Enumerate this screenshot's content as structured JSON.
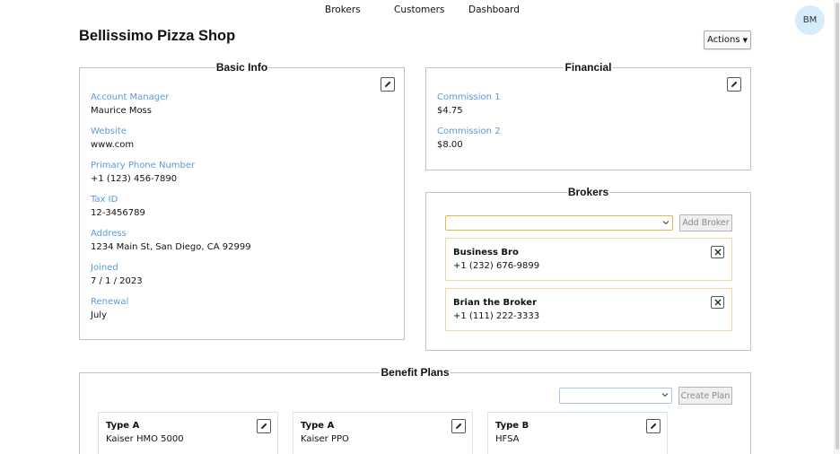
{
  "nav": {
    "items": [
      "Brokers",
      "Customers",
      "Dashboard"
    ]
  },
  "user": {
    "initials": "BM"
  },
  "page": {
    "title": "Bellissimo Pizza Shop",
    "actions_label": "Actions"
  },
  "basic_info": {
    "legend": "Basic Info",
    "fields": [
      {
        "label": "Account Manager",
        "value": "Maurice Moss"
      },
      {
        "label": "Website",
        "value": "www.com"
      },
      {
        "label": "Primary Phone Number",
        "value": "+1 (123) 456-7890"
      },
      {
        "label": "Tax ID",
        "value": "12-3456789"
      },
      {
        "label": "Address",
        "value": "1234 Main St, San Diego, CA 92999"
      },
      {
        "label": "Joined",
        "value": "7 / 1 / 2023"
      },
      {
        "label": "Renewal",
        "value": "July"
      }
    ]
  },
  "financial": {
    "legend": "Financial",
    "fields": [
      {
        "label": "Commission 1",
        "value": "$4.75"
      },
      {
        "label": "Commission 2",
        "value": "$8.00"
      }
    ]
  },
  "brokers": {
    "legend": "Brokers",
    "select_value": "",
    "add_label": "Add Broker",
    "list": [
      {
        "name": "Business Bro",
        "phone": "+1 (232) 676-9899"
      },
      {
        "name": "Brian the Broker",
        "phone": "+1 (111) 222-3333"
      }
    ]
  },
  "benefit_plans": {
    "legend": "Benefit Plans",
    "select_value": "",
    "create_label": "Create Plan",
    "plans": [
      {
        "type": "Type A",
        "name": "Kaiser HMO 5000"
      },
      {
        "type": "Type A",
        "name": "Kaiser PPO"
      },
      {
        "type": "Type B",
        "name": "HFSA"
      }
    ]
  },
  "colors": {
    "field_label": "#5b9bd5",
    "avatar_bg": "#d6ecfb",
    "broker_card_border": "#f0d7a6",
    "select_border": "#e3b84b"
  }
}
